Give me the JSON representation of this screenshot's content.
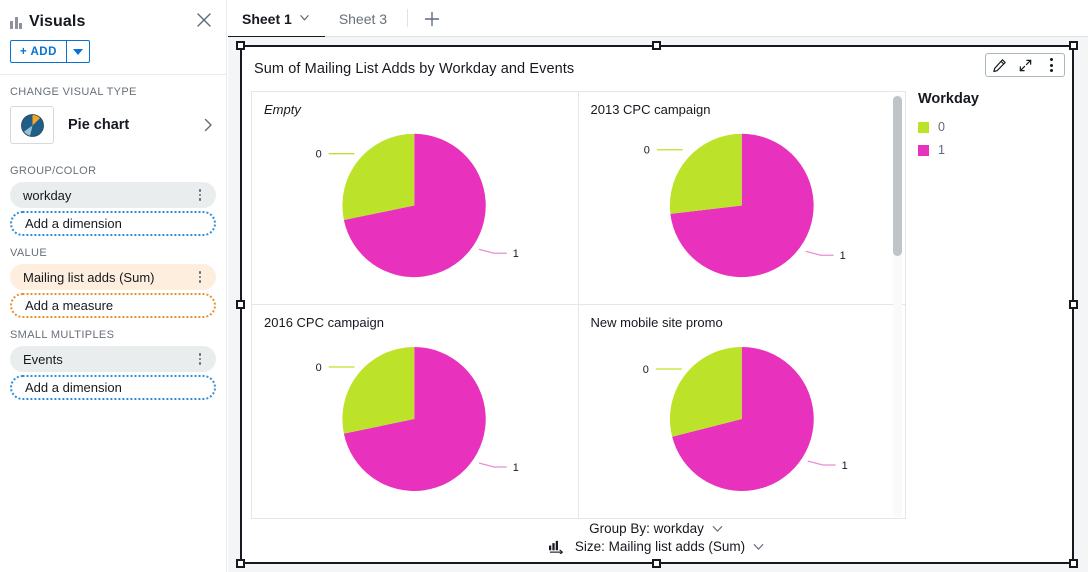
{
  "left_panel": {
    "title": "Visuals",
    "title_icon": "bar-chart-icon",
    "close_icon": "close-icon",
    "add_button": {
      "label": "+ ADD",
      "caret_icon": "caret-down-icon"
    },
    "change_visual_type_label": "CHANGE VISUAL TYPE",
    "visual_type": {
      "name": "Pie chart",
      "thumb_icon": "pie-chart-icon",
      "chevron_icon": "chevron-right-icon"
    },
    "sections": [
      {
        "label": "GROUP/COLOR",
        "fields": [
          {
            "name": "workday",
            "kind": "dimension",
            "menu_icon": "kebab-menu-icon"
          }
        ],
        "placeholder": {
          "label": "Add a dimension",
          "kind": "dimension"
        }
      },
      {
        "label": "VALUE",
        "fields": [
          {
            "name": "Mailing list adds (Sum)",
            "kind": "measure",
            "menu_icon": "kebab-menu-icon"
          }
        ],
        "placeholder": {
          "label": "Add a measure",
          "kind": "measure"
        }
      },
      {
        "label": "SMALL MULTIPLES",
        "fields": [
          {
            "name": "Events",
            "kind": "dimension",
            "menu_icon": "kebab-menu-icon"
          }
        ],
        "placeholder": {
          "label": "Add a dimension",
          "kind": "dimension"
        }
      }
    ]
  },
  "tabbar": {
    "tabs": [
      {
        "label": "Sheet 1",
        "active": true,
        "has_caret": true
      },
      {
        "label": "Sheet 3",
        "active": false,
        "has_caret": false
      }
    ],
    "add_tab_icon": "plus-icon"
  },
  "visual": {
    "title": "Sum of Mailing List Adds by Workday and Events",
    "selected": true,
    "toolbar": [
      {
        "icon": "pencil-edit-icon",
        "name": "edit-visual-button"
      },
      {
        "icon": "expand-arrows-icon",
        "name": "maximize-visual-button"
      },
      {
        "icon": "kebab-menu-icon",
        "name": "visual-menu-button"
      }
    ],
    "legend": {
      "title": "Workday",
      "items": [
        {
          "label": "0",
          "color": "#bce32a"
        },
        {
          "label": "1",
          "color": "#e831bc"
        }
      ]
    },
    "footer": {
      "group_by": {
        "prefix": "Group By:",
        "value": "workday",
        "text": "Group By: workday",
        "chevron_icon": "chevron-down-icon"
      },
      "size": {
        "prefix": "Size:",
        "value": "Mailing list adds (Sum)",
        "text": "Size: Mailing list adds (Sum)",
        "icon": "size-measure-icon",
        "chevron_icon": "chevron-down-icon"
      }
    },
    "scrollbar": {
      "name": "small-multiples-scrollbar",
      "thumb_top_pct": 1,
      "thumb_height_pct": 38
    }
  },
  "chart_data": {
    "type": "pie",
    "title": "Sum of Mailing List Adds by Workday and Events",
    "legend_title": "Workday",
    "legend_position": "right",
    "small_multiples_dimension": "Events",
    "group_dimension": "workday",
    "value_measure": "Mailing list adds (Sum)",
    "colors": {
      "0": "#bce32a",
      "1": "#e831bc"
    },
    "panels": [
      {
        "title": "Empty",
        "italic_title": true,
        "labels": [
          "0",
          "1"
        ],
        "values": [
          28,
          72
        ],
        "slices": [
          {
            "label": "0",
            "value": 28,
            "color": "#bce32a",
            "start_deg": 0,
            "end_deg": -101
          },
          {
            "label": "1",
            "value": 72,
            "color": "#e831bc",
            "start_deg": 0,
            "end_deg": 259
          }
        ]
      },
      {
        "title": "2013 CPC campaign",
        "italic_title": false,
        "labels": [
          "0",
          "1"
        ],
        "values": [
          27,
          73
        ],
        "slices": [
          {
            "label": "0",
            "value": 27,
            "color": "#bce32a",
            "start_deg": 0,
            "end_deg": -97
          },
          {
            "label": "1",
            "value": 73,
            "color": "#e831bc",
            "start_deg": 0,
            "end_deg": 263
          }
        ]
      },
      {
        "title": "2016 CPC campaign",
        "italic_title": false,
        "labels": [
          "0",
          "1"
        ],
        "values": [
          28,
          72
        ],
        "slices": [
          {
            "label": "0",
            "value": 28,
            "color": "#bce32a",
            "start_deg": 0,
            "end_deg": -101
          },
          {
            "label": "1",
            "value": 72,
            "color": "#e831bc",
            "start_deg": 0,
            "end_deg": 259
          }
        ]
      },
      {
        "title": "New mobile site promo",
        "italic_title": false,
        "labels": [
          "0",
          "1"
        ],
        "values": [
          29,
          71
        ],
        "slices": [
          {
            "label": "0",
            "value": 29,
            "color": "#bce32a",
            "start_deg": 0,
            "end_deg": -104
          },
          {
            "label": "1",
            "value": 71,
            "color": "#e831bc",
            "start_deg": 0,
            "end_deg": 256
          }
        ]
      }
    ]
  }
}
